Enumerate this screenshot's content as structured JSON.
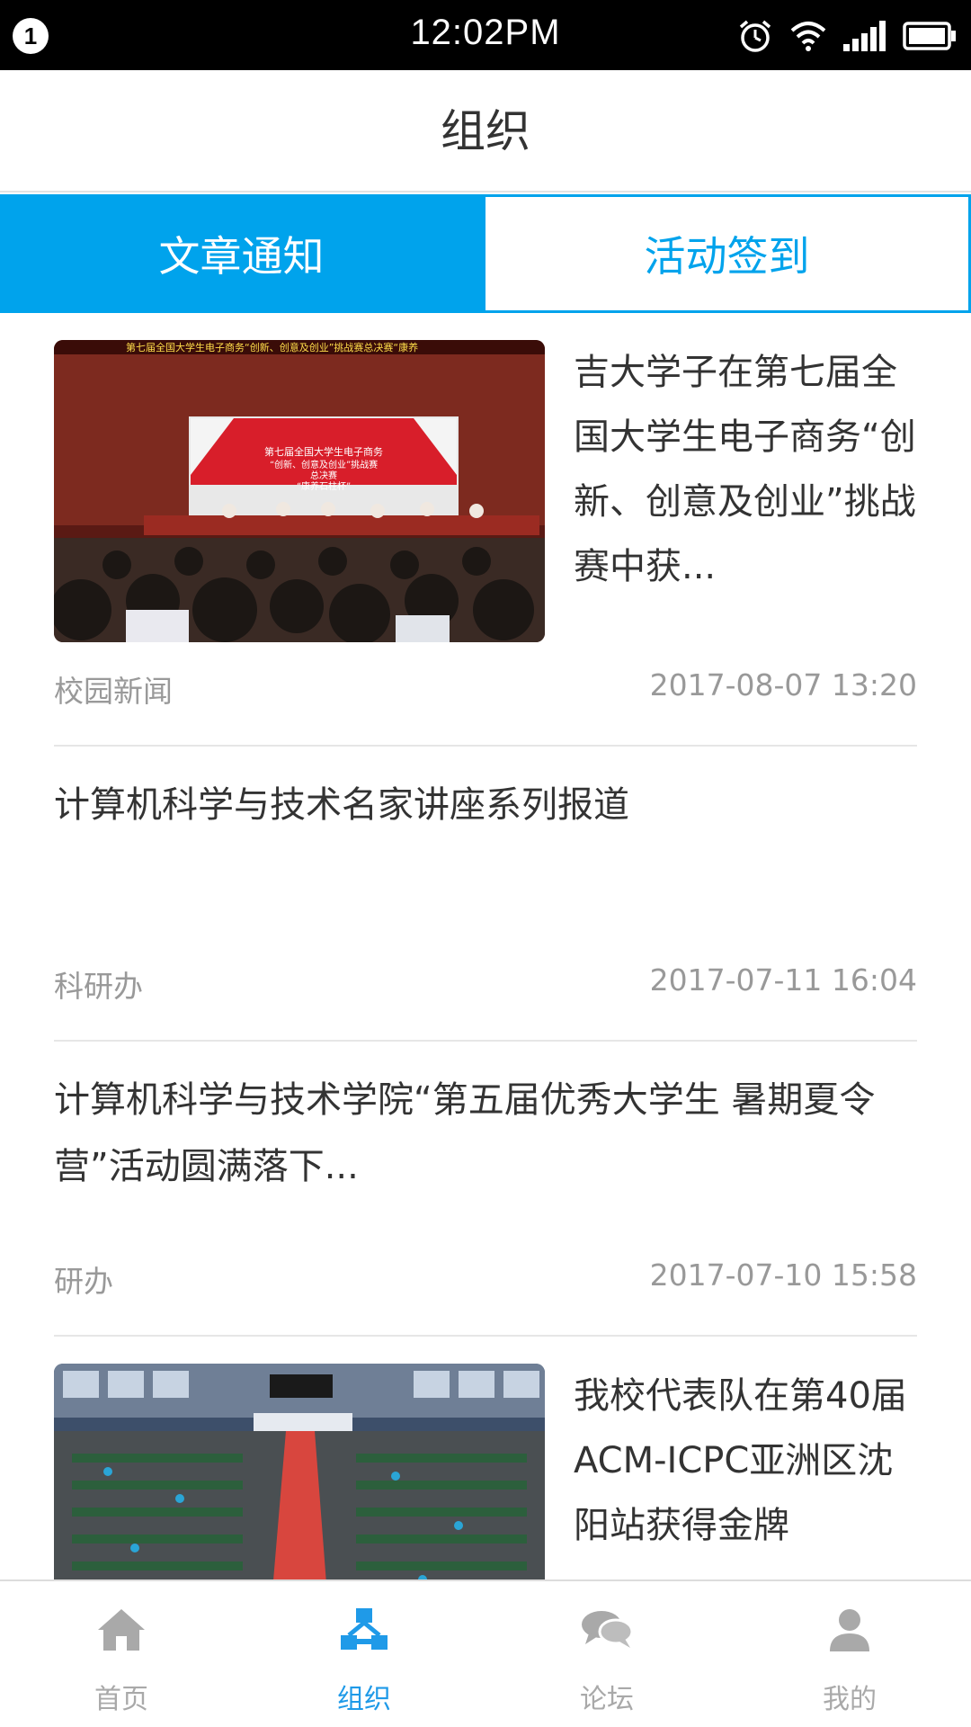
{
  "status_bar": {
    "notification_count": "1",
    "time": "12:02PM",
    "icons": [
      "alarm-icon",
      "wifi-icon",
      "signal-icon",
      "battery-icon"
    ]
  },
  "header": {
    "title": "组织"
  },
  "tabs": [
    {
      "label": "文章通知",
      "active": true
    },
    {
      "label": "活动签到",
      "active": false
    }
  ],
  "articles": [
    {
      "title": "吉大学子在第七届全国大学生电子商务“创新、创意及创业”挑战赛中获...",
      "source": "校园新闻",
      "date": "2017-08-07 13:20",
      "image": {
        "banner_top": "第七届全国大学生电子商务“创新、创意及创业”挑战赛总决赛“康养",
        "screen_lines": [
          "第七届全国大学生电子商务",
          "“创新、创意及创业”挑战赛",
          "总决赛",
          "“康养石柱杯”"
        ]
      }
    },
    {
      "title": "计算机科学与技术名家讲座系列报道",
      "source": "科研办",
      "date": "2017-07-11 16:04"
    },
    {
      "title": "计算机科学与技术学院“第五届优秀大学生 暑期夏令营”活动圆满落下...",
      "source": "研办",
      "date": "2017-07-10 15:58"
    },
    {
      "title": "我校代表队在第40届ACM-ICPC亚洲区沈阳站获得金牌"
    }
  ],
  "bottom_nav": [
    {
      "label": "首页",
      "icon": "home-icon",
      "active": false
    },
    {
      "label": "组织",
      "icon": "organization-icon",
      "active": true
    },
    {
      "label": "论坛",
      "icon": "forum-icon",
      "active": false
    },
    {
      "label": "我的",
      "icon": "profile-icon",
      "active": false
    }
  ],
  "colors": {
    "accent": "#00a3ec",
    "text_primary": "#333333",
    "text_secondary": "#999999",
    "nav_inactive": "#a9a9a9"
  }
}
